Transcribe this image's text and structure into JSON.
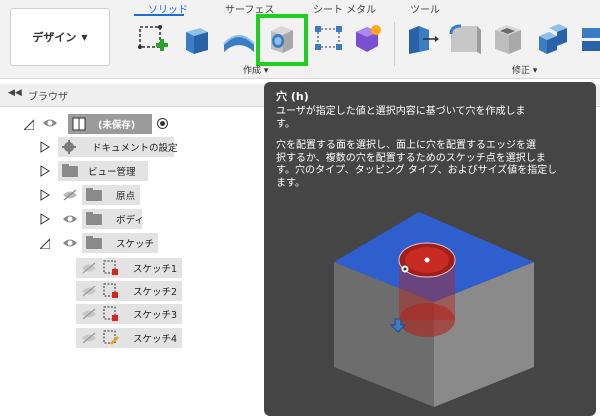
{
  "workspace": {
    "label": "デザイン"
  },
  "tabs": [
    {
      "label": "ソリッド",
      "active": true
    },
    {
      "label": "サーフェス",
      "active": false
    },
    {
      "label": "シート メタル",
      "active": false
    },
    {
      "label": "ツール",
      "active": false
    }
  ],
  "groups": {
    "create": "作成 ▾",
    "modify": "修正 ▾"
  },
  "tool_icons": [
    "sketch-icon",
    "extrude-icon",
    "revolve-icon",
    "hole-icon",
    "pattern-icon",
    "create-form-icon",
    "press-pull-icon",
    "fillet-icon",
    "shell-icon",
    "combine-icon",
    "split-icon"
  ],
  "browser": {
    "title": "ブラウザ",
    "root_label": "(未保存)",
    "items": [
      {
        "label": "ドキュメントの設定"
      },
      {
        "label": "ビュー管理"
      },
      {
        "label": "原点"
      },
      {
        "label": "ボディ"
      },
      {
        "label": "スケッチ"
      }
    ],
    "sketches": [
      "スケッチ1",
      "スケッチ2",
      "スケッチ3",
      "スケッチ4"
    ]
  },
  "tooltip": {
    "title": "穴 (h)",
    "line1a": "ユーザが指定した値と選択内容に基づいて穴を作成しま",
    "line1b": "す。",
    "line2a": "穴を配置する面を選択し、面上に穴を配置するエッジを選",
    "line2b": "択するか、複数の穴を配置するためのスケッチ点を選択しま",
    "line2c": "す。穴のタイプ、タッピング タイプ、およびサイズ値を指定し",
    "line2d": "ます。"
  },
  "colors": {
    "highlight": "#1fd01f",
    "tooltip_bg": "#454545",
    "face_blue": "#2f5fcf",
    "hole_red": "#b3231d",
    "accent": "#1d6fd1"
  }
}
